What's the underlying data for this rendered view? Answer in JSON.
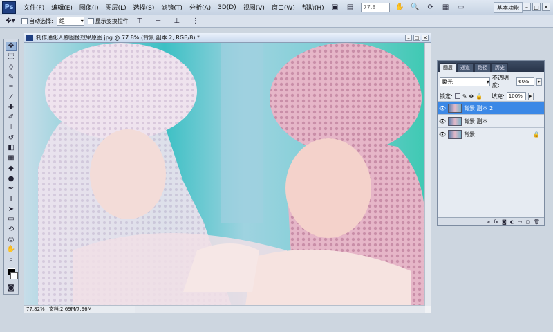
{
  "menubar": {
    "logo": "Ps",
    "items": [
      "文件(F)",
      "编辑(E)",
      "图像(I)",
      "图层(L)",
      "选择(S)",
      "滤镜(T)",
      "分析(A)",
      "3D(D)",
      "视图(V)",
      "窗口(W)",
      "帮助(H)"
    ],
    "zoom": "77.8",
    "workspace": "基本功能"
  },
  "options": {
    "auto_select_label": "自动选择:",
    "auto_select_value": "组",
    "show_transform_label": "显示变换控件"
  },
  "document": {
    "title": "制作通化人物图像效果原图.jpg @ 77.8% (背景 副本 2, RGB/8) *",
    "zoom_status": "77.82%",
    "doc_size": "文档:2.69M/7.96M"
  },
  "layers_panel": {
    "tabs": [
      "图层",
      "通道",
      "路径",
      "历史"
    ],
    "blend_mode": "柔光",
    "opacity_label": "不透明度:",
    "opacity": "60%",
    "lock_label": "锁定:",
    "fill_label": "填充:",
    "fill": "100%",
    "layers": [
      {
        "name": "背景 副本 2",
        "selected": true
      },
      {
        "name": "背景 副本",
        "selected": false
      },
      {
        "name": "背景",
        "selected": false
      }
    ]
  },
  "colors": {
    "selected_layer": "#3b88e6",
    "photo_pink": "#e9b8c9",
    "photo_teal": "#2fb8b0"
  }
}
